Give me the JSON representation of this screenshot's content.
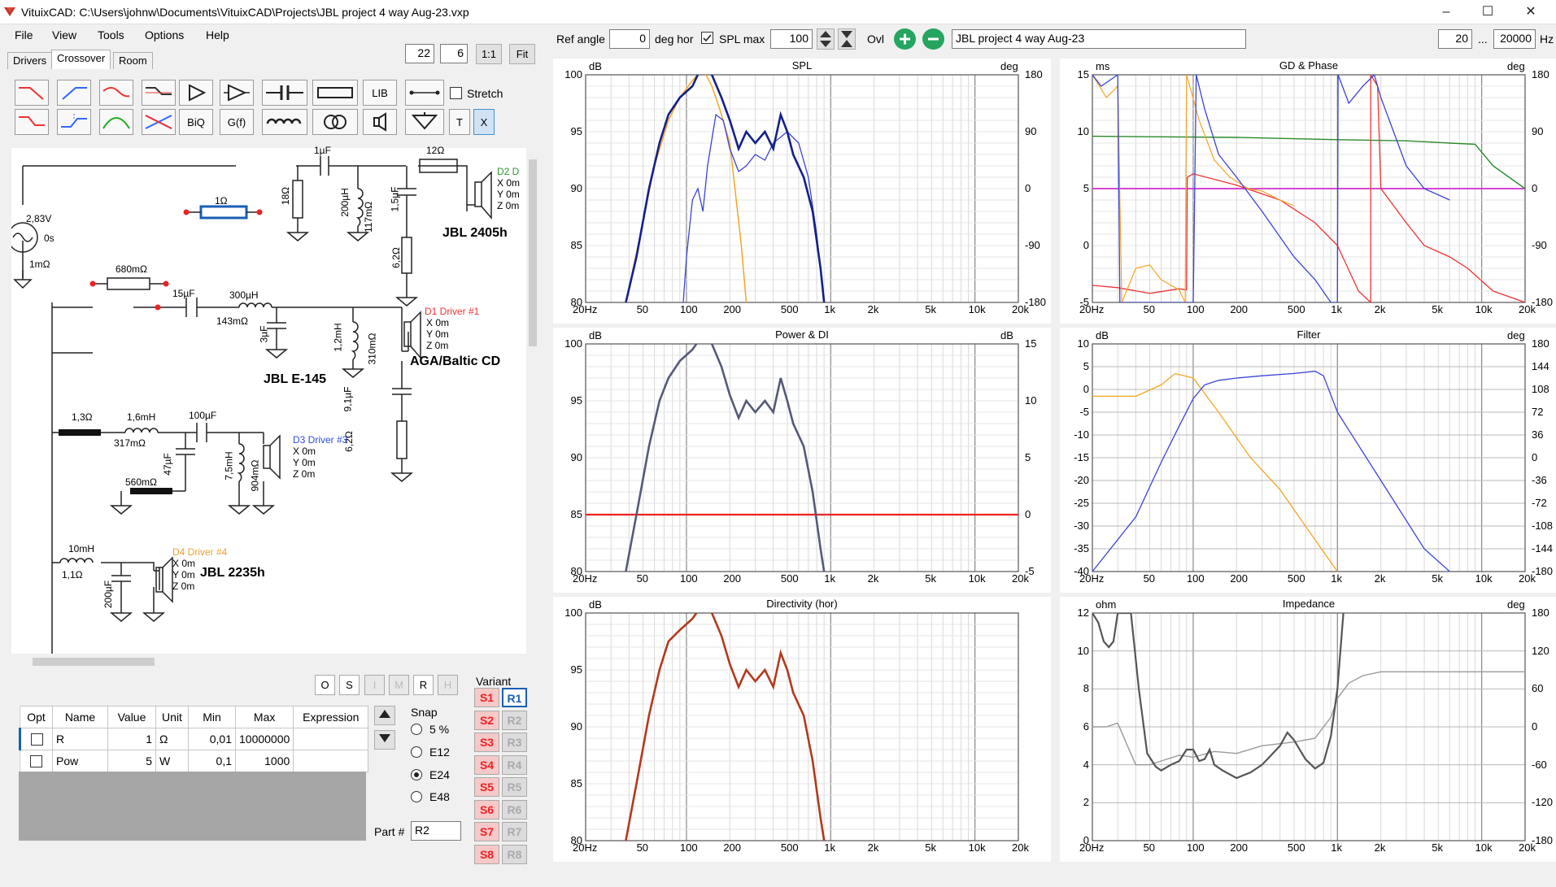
{
  "window": {
    "title": "VituixCAD: C:\\Users\\johnw\\Documents\\VituixCAD\\Projects\\JBL project 4 way Aug-23.vxp",
    "minimize": "–",
    "maximize": "☐",
    "close": "✕"
  },
  "menu": [
    "File",
    "View",
    "Tools",
    "Options",
    "Help"
  ],
  "tabs": [
    "Drivers",
    "Crossover",
    "Room"
  ],
  "zoom": {
    "a": "22",
    "b": "6",
    "one": "1:1",
    "fit": "Fit"
  },
  "toolbar": {
    "lib": "LIB",
    "biq": "BiQ",
    "gf": "G(f)",
    "t": "T",
    "x": "X",
    "stretch": "Stretch"
  },
  "schematic": {
    "src_v": "2,83V",
    "src_deg": "0s",
    "src_r": "1mΩ",
    "r1": "1Ω",
    "r680": "680mΩ",
    "c1u": "1µF",
    "r12": "12Ω",
    "r18": "18Ω",
    "l200": "200µH",
    "l200r": "117mΩ",
    "c15": "1,5µF",
    "r62a": "6,2Ω",
    "d2": "D2 D",
    "d2x": "X 0m",
    "d2y": "Y 0m",
    "d2z": "Z 0m",
    "d2name": "JBL 2405h",
    "c15u": "15µF",
    "l300": "300µH",
    "l300r": "143mΩ",
    "c3": "3µF",
    "l12": "1,2mH",
    "l12r": "310mΩ",
    "d1": "D1 Driver #1",
    "d1x": "X 0m",
    "d1y": "Y 0m",
    "d1z": "Z 0m",
    "d1name": "AGA/Baltic CD",
    "je145": "JBL E-145",
    "c91": "9,1µF",
    "r62b": "6,2Ω",
    "r13": "1,3Ω",
    "l16": "1,6mH",
    "l16r": "317mΩ",
    "c100": "100µF",
    "c47": "47µF",
    "r560": "560mΩ",
    "l75": "7,5mH",
    "l75r": "904mΩ",
    "d3": "D3 Driver #3",
    "d3x": "X 0m",
    "d3y": "Y 0m",
    "d3z": "Z 0m",
    "l10": "10mH",
    "l10r": "1,1Ω",
    "c200": "200µF",
    "d4": "D4 Driver #4",
    "d4x": "X 0m",
    "d4y": "Y 0m",
    "d4z": "Z 0m",
    "d4name": "JBL 2235h"
  },
  "part_buttons": [
    "O",
    "S",
    "I",
    "M",
    "R",
    "H"
  ],
  "grid": {
    "headers": [
      "Opt",
      "Name",
      "Value",
      "Unit",
      "Min",
      "Max",
      "Expression"
    ],
    "rows": [
      [
        "",
        "R",
        "1",
        "Ω",
        "0,01",
        "10000000",
        ""
      ],
      [
        "",
        "Pow",
        "5",
        "W",
        "0,1",
        "1000",
        ""
      ]
    ]
  },
  "snap": {
    "label": "Snap",
    "options": [
      "5 %",
      "E12",
      "E24",
      "E48"
    ],
    "selected": "E24"
  },
  "partnum": {
    "label": "Part #",
    "value": "R2"
  },
  "variant": {
    "label": "Variant",
    "s": [
      "S1",
      "S2",
      "S3",
      "S4",
      "S5",
      "S6",
      "S7",
      "S8"
    ],
    "r": [
      "R1",
      "R2",
      "R3",
      "R4",
      "R5",
      "R6",
      "R7",
      "R8"
    ]
  },
  "top": {
    "ref_angle_label": "Ref angle",
    "ref_angle": "0",
    "deg_hor": "deg hor",
    "spl_max_label": "SPL max",
    "spl_max": "100",
    "ovl": "Ovl",
    "project": "JBL project 4 way Aug-23",
    "f_lo": "20",
    "dots": "...",
    "f_hi": "20000",
    "hz": "Hz"
  },
  "charts": {
    "xticks": [
      "20Hz",
      "50",
      "100",
      "200",
      "500",
      "1k",
      "2k",
      "5k",
      "10k",
      "20k"
    ],
    "spl": {
      "title": "SPL",
      "left_unit": "dB",
      "right_unit": "deg",
      "left": [
        "100",
        "95",
        "90",
        "85",
        "80"
      ],
      "right": [
        "180",
        "90",
        "0",
        "-90",
        "-180"
      ]
    },
    "gd": {
      "title": "GD & Phase",
      "left_unit": "ms",
      "right_unit": "deg",
      "left": [
        "15",
        "10",
        "5",
        "0",
        "-5"
      ],
      "right": [
        "180",
        "90",
        "0",
        "-90",
        "-180"
      ]
    },
    "power": {
      "title": "Power & DI",
      "left_unit": "dB",
      "right_unit": "dB",
      "left": [
        "100",
        "95",
        "90",
        "85",
        "80"
      ],
      "right": [
        "15",
        "10",
        "5",
        "0",
        "-5"
      ]
    },
    "filter": {
      "title": "Filter",
      "left_unit": "dB",
      "right_unit": "deg",
      "left": [
        "10",
        "5",
        "0",
        "-5",
        "-10",
        "-15",
        "-20",
        "-25",
        "-30",
        "-35",
        "-40"
      ],
      "right": [
        "180",
        "144",
        "108",
        "72",
        "36",
        "0",
        "-36",
        "-72",
        "-108",
        "-144",
        "-180"
      ]
    },
    "dir": {
      "title": "Directivity (hor)",
      "left_unit": "dB",
      "left": [
        "100",
        "95",
        "90",
        "85",
        "80"
      ]
    },
    "imp": {
      "title": "Impedance",
      "left_unit": "ohm",
      "right_unit": "deg",
      "left": [
        "12",
        "10",
        "8",
        "6",
        "4",
        "2",
        "0"
      ],
      "right": [
        "180",
        "120",
        "60",
        "0",
        "-60",
        "-120",
        "-180"
      ]
    }
  }
}
